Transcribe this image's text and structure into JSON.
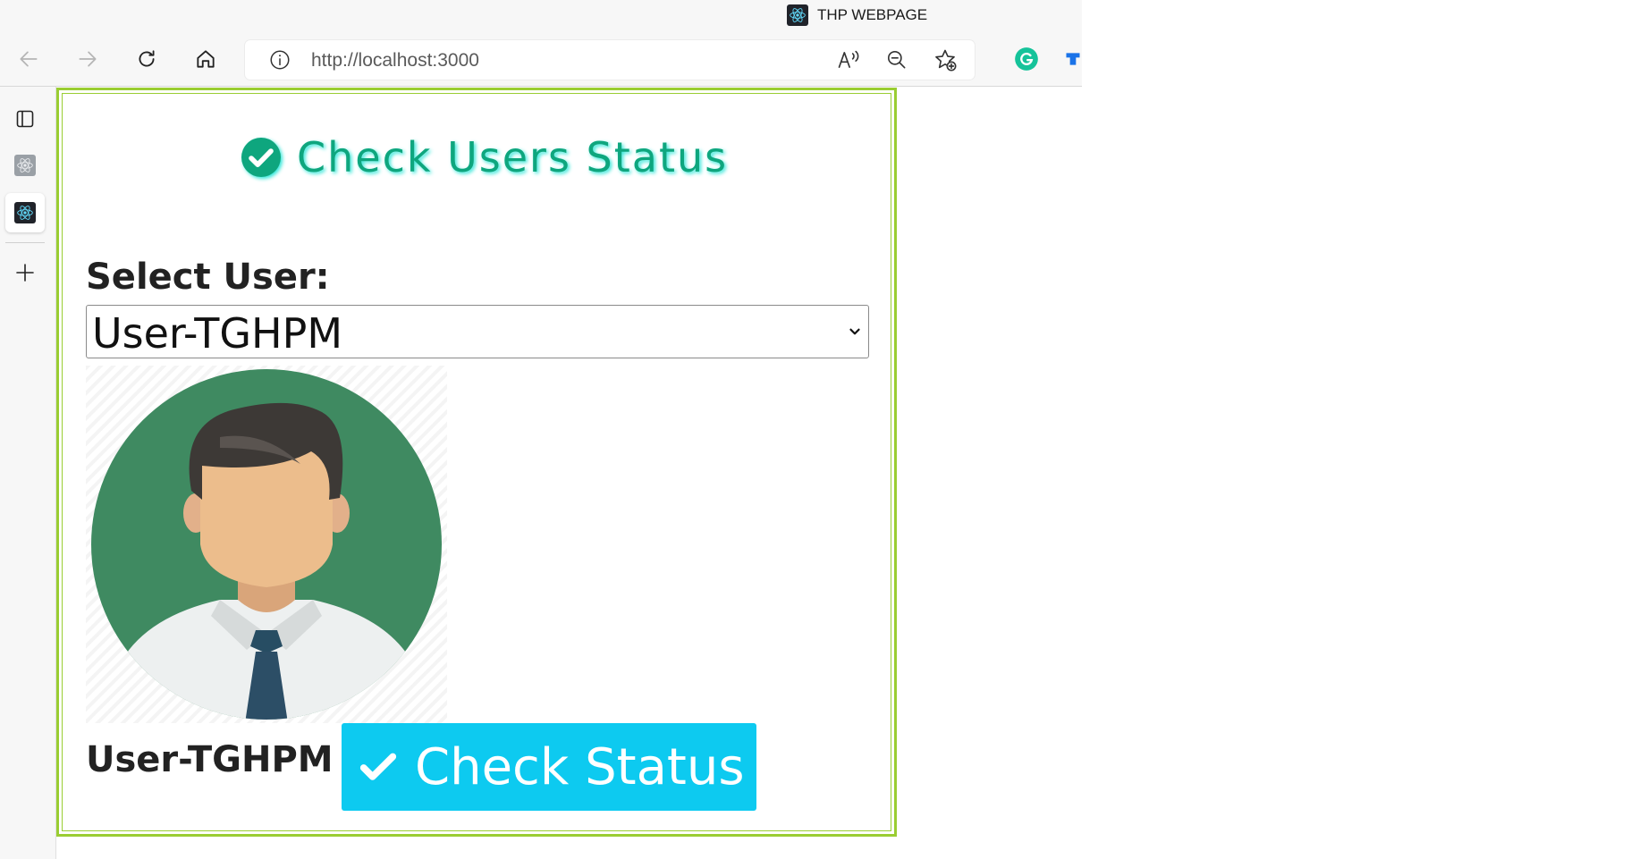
{
  "browser": {
    "tab": {
      "title": "THP WEBPAGE",
      "icon": "react-logo-icon"
    },
    "address": {
      "host": "http://localhost",
      "port": ":3000"
    },
    "toolbar_icons": [
      "back-icon",
      "forward-icon",
      "refresh-icon",
      "home-icon",
      "site-info-icon",
      "read-aloud-icon",
      "zoom-out-icon",
      "add-favorite-icon",
      "grammarly-icon",
      "extension-icon"
    ],
    "sidebar_icons": [
      "tab-actions-icon",
      "react-logo-icon",
      "react-logo-icon",
      "new-tab-icon"
    ]
  },
  "page": {
    "heading": "Check Users Status",
    "heading_icon": "check-circle-icon",
    "select_label": "Select User:",
    "selected_user": "User-TGHPM",
    "user_name": "User-TGHPM",
    "check_button_label": "Check Status",
    "check_button_icon": "check-icon"
  },
  "colors": {
    "heading": "#0ea67e",
    "heading_glow": "#2fe6d8",
    "card_border": "#9acd32",
    "button_bg": "#0dcaf0",
    "avatar_bg": "#3f8a61"
  }
}
